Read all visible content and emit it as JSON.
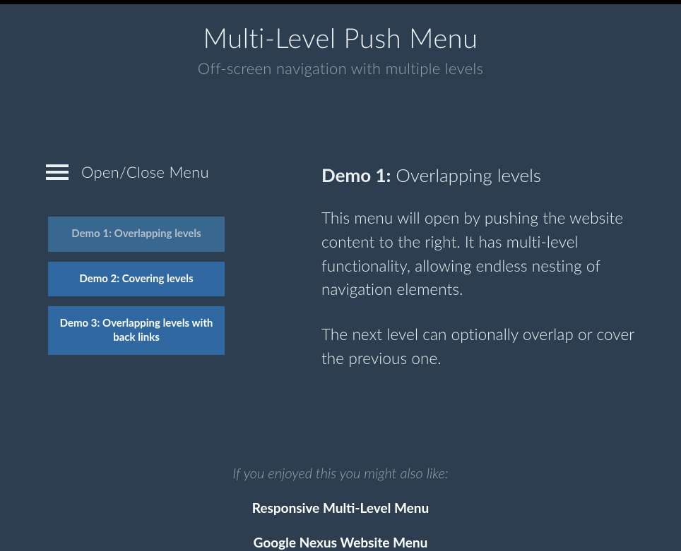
{
  "header": {
    "title": "Multi-Level Push Menu",
    "subtitle": "Off-screen navigation with multiple levels"
  },
  "trigger": {
    "label": "Open/Close Menu"
  },
  "demos": [
    {
      "label": "Demo 1: Overlapping levels",
      "current": true
    },
    {
      "label": "Demo 2: Covering levels",
      "current": false
    },
    {
      "label": "Demo 3: Overlapping levels with back links",
      "current": false
    }
  ],
  "content": {
    "demo_label": "Demo 1:",
    "demo_suffix": " Overlapping levels",
    "paragraphs": [
      "This menu will open by pushing the website content to the right. It has multi-level functionality, allowing endless nesting of navigation elements.",
      "The next level can optionally overlap or cover the previous one."
    ]
  },
  "related": {
    "intro": "If you enjoyed this you might also like:",
    "links": [
      "Responsive Multi-Level Menu",
      "Google Nexus Website Menu"
    ]
  }
}
